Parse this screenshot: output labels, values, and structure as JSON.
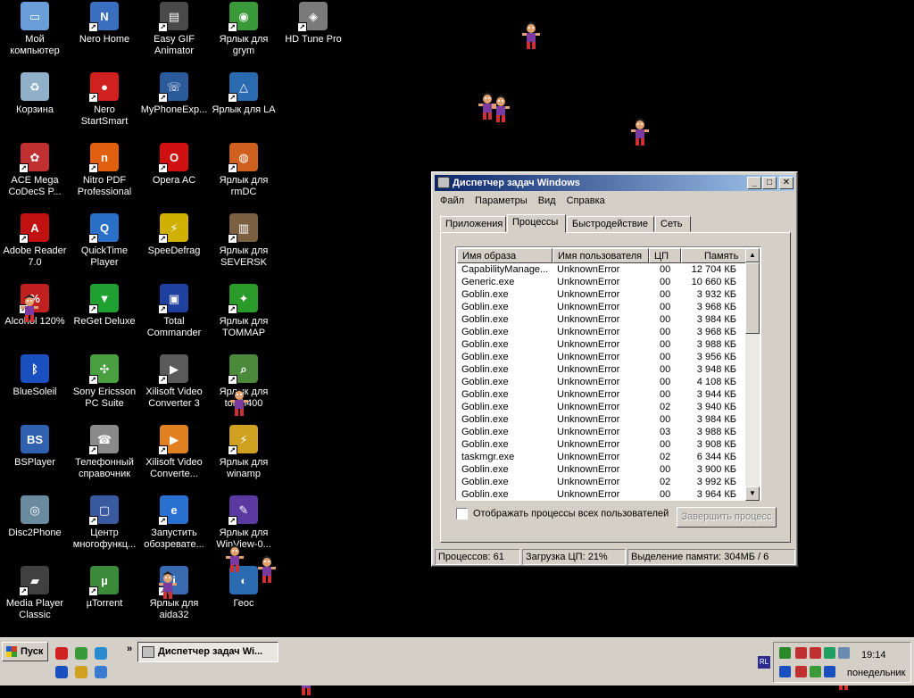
{
  "desktop_icons": [
    {
      "label": "Мой\nкомпьютер",
      "icon": "my-computer-icon",
      "color": "#6a9ed8",
      "glyph": "▭",
      "shortcut": false
    },
    {
      "label": "Nero Home",
      "icon": "nero-home-icon",
      "color": "#3a6fc0",
      "glyph": "N",
      "shortcut": true
    },
    {
      "label": "Easy GIF\nAnimator",
      "icon": "film-icon",
      "color": "#4a4a4a",
      "glyph": "▤",
      "shortcut": true
    },
    {
      "label": "Ярлык для\ngrym",
      "icon": "grym-icon",
      "color": "#3a9a3a",
      "glyph": "◉",
      "shortcut": true
    },
    {
      "label": "HD Tune Pro",
      "icon": "hd-tune-icon",
      "color": "#7a7a7a",
      "glyph": "◈",
      "shortcut": true
    },
    {
      "label": "Корзина",
      "icon": "recycle-bin-icon",
      "color": "#8fb0c8",
      "glyph": "♻",
      "shortcut": false
    },
    {
      "label": "Nero\nStartSmart",
      "icon": "nero-startsmart-icon",
      "color": "#d02020",
      "glyph": "●",
      "shortcut": true
    },
    {
      "label": "MyPhoneExp...",
      "icon": "myphone-icon",
      "color": "#2a5a9a",
      "glyph": "☏",
      "shortcut": true
    },
    {
      "label": "Ярлык для LA",
      "icon": "la-icon",
      "color": "#2a6ab0",
      "glyph": "△",
      "shortcut": true
    },
    {
      "label": "ACE Mega\nCoDecS P...",
      "icon": "ace-codec-icon",
      "color": "#c03030",
      "glyph": "✿",
      "shortcut": true
    },
    {
      "label": "Nitro PDF\nProfessional",
      "icon": "nitro-pdf-icon",
      "color": "#e06010",
      "glyph": "n",
      "shortcut": true
    },
    {
      "label": "Opera AC",
      "icon": "opera-icon",
      "color": "#d01010",
      "glyph": "O",
      "shortcut": true
    },
    {
      "label": "Ярлык для\nrmDC",
      "icon": "rmdc-icon",
      "color": "#d06020",
      "glyph": "◍",
      "shortcut": true
    },
    {
      "label": "Adobe Reader\n7.0",
      "icon": "adobe-reader-icon",
      "color": "#c01010",
      "glyph": "A",
      "shortcut": true
    },
    {
      "label": "QuickTime\nPlayer",
      "icon": "quicktime-icon",
      "color": "#2a70c8",
      "glyph": "Q",
      "shortcut": true
    },
    {
      "label": "SpeeDefrag",
      "icon": "lightning-icon",
      "color": "#d0b000",
      "glyph": "⚡",
      "shortcut": true
    },
    {
      "label": "Ярлык для\nSEVERSK",
      "icon": "book-icon",
      "color": "#7a6040",
      "glyph": "▥",
      "shortcut": true
    },
    {
      "label": "Alcohol 120%",
      "icon": "alcohol-icon",
      "color": "#c02020",
      "glyph": "%",
      "shortcut": true
    },
    {
      "label": "ReGet Deluxe",
      "icon": "reget-icon",
      "color": "#20a030",
      "glyph": "▼",
      "shortcut": true
    },
    {
      "label": "Total\nCommander",
      "icon": "floppy-icon",
      "color": "#2040a0",
      "glyph": "▣",
      "shortcut": true
    },
    {
      "label": "Ярлык для\nTOMMAP",
      "icon": "tommap-icon",
      "color": "#2a9a2a",
      "glyph": "✦",
      "shortcut": true
    },
    {
      "label": "BlueSoleil",
      "icon": "bluetooth-icon",
      "color": "#1a4fc0",
      "glyph": "ᛒ",
      "shortcut": false
    },
    {
      "label": "Sony Ericsson\nPC Suite",
      "icon": "sony-ericsson-icon",
      "color": "#4aa040",
      "glyph": "✣",
      "shortcut": true
    },
    {
      "label": "Xilisoft Video\nConverter 3",
      "icon": "video-converter-icon",
      "color": "#5a5a5a",
      "glyph": "▶",
      "shortcut": true
    },
    {
      "label": "Ярлык для\ntorch400",
      "icon": "magnifier-icon",
      "color": "#4a8a3a",
      "glyph": "⌕",
      "shortcut": true
    },
    {
      "label": "BSPlayer",
      "icon": "bsplayer-icon",
      "color": "#3060b0",
      "glyph": "BS",
      "shortcut": false
    },
    {
      "label": "Телефонный\nсправочник",
      "icon": "telephone-icon",
      "color": "#8a8a8a",
      "glyph": "☎",
      "shortcut": true
    },
    {
      "label": "Xilisoft Video\nConverte...",
      "icon": "video-converter-icon",
      "color": "#e08020",
      "glyph": "▶",
      "shortcut": true
    },
    {
      "label": "Ярлык для\nwinamp",
      "icon": "winamp-icon",
      "color": "#d0a020",
      "glyph": "⚡",
      "shortcut": true
    },
    {
      "label": "Disc2Phone",
      "icon": "disc2phone-icon",
      "color": "#6a8aa0",
      "glyph": "◎",
      "shortcut": false
    },
    {
      "label": "Центр\nмногофункц...",
      "icon": "multifunction-center-icon",
      "color": "#3a5aa0",
      "glyph": "▢",
      "shortcut": true
    },
    {
      "label": "Запустить\nобозревате...",
      "icon": "internet-explorer-icon",
      "color": "#2a70d0",
      "glyph": "e",
      "shortcut": true
    },
    {
      "label": "Ярлык для\nWinView-0...",
      "icon": "winview-icon",
      "color": "#5a3aa0",
      "glyph": "✎",
      "shortcut": true
    },
    {
      "label": "Media Player\nClassic",
      "icon": "clapperboard-icon",
      "color": "#404040",
      "glyph": "▰",
      "shortcut": true
    },
    {
      "label": "µTorrent",
      "icon": "utorrent-icon",
      "color": "#3a8a3a",
      "glyph": "µ",
      "shortcut": true
    },
    {
      "label": "Ярлык для\naida32",
      "icon": "aida32-icon",
      "color": "#3a6ab0",
      "glyph": "i",
      "shortcut": true
    },
    {
      "label": "Геос",
      "icon": "globe-icon",
      "color": "#2a6ab0",
      "glyph": "◐",
      "shortcut": false
    }
  ],
  "task_manager": {
    "title": "Диспетчер задач Windows",
    "menu": [
      "Файл",
      "Параметры",
      "Вид",
      "Справка"
    ],
    "tabs": [
      "Приложения",
      "Процессы",
      "Быстродействие",
      "Сеть"
    ],
    "active_tab": "Процессы",
    "columns": [
      "Имя образа",
      "Имя пользователя",
      "ЦП",
      "Память"
    ],
    "processes": [
      {
        "name": "CapabilityManage...",
        "user": "UnknownError",
        "cpu": "00",
        "mem": "12 704 КБ"
      },
      {
        "name": "Generic.exe",
        "user": "UnknownError",
        "cpu": "00",
        "mem": "10 660 КБ"
      },
      {
        "name": "Goblin.exe",
        "user": "UnknownError",
        "cpu": "00",
        "mem": "3 932 КБ"
      },
      {
        "name": "Goblin.exe",
        "user": "UnknownError",
        "cpu": "00",
        "mem": "3 968 КБ"
      },
      {
        "name": "Goblin.exe",
        "user": "UnknownError",
        "cpu": "00",
        "mem": "3 984 КБ"
      },
      {
        "name": "Goblin.exe",
        "user": "UnknownError",
        "cpu": "00",
        "mem": "3 968 КБ"
      },
      {
        "name": "Goblin.exe",
        "user": "UnknownError",
        "cpu": "00",
        "mem": "3 988 КБ"
      },
      {
        "name": "Goblin.exe",
        "user": "UnknownError",
        "cpu": "00",
        "mem": "3 956 КБ"
      },
      {
        "name": "Goblin.exe",
        "user": "UnknownError",
        "cpu": "00",
        "mem": "3 948 КБ"
      },
      {
        "name": "Goblin.exe",
        "user": "UnknownError",
        "cpu": "00",
        "mem": "4 108 КБ"
      },
      {
        "name": "Goblin.exe",
        "user": "UnknownError",
        "cpu": "00",
        "mem": "3 944 КБ"
      },
      {
        "name": "Goblin.exe",
        "user": "UnknownError",
        "cpu": "02",
        "mem": "3 940 КБ"
      },
      {
        "name": "Goblin.exe",
        "user": "UnknownError",
        "cpu": "00",
        "mem": "3 984 КБ"
      },
      {
        "name": "Goblin.exe",
        "user": "UnknownError",
        "cpu": "03",
        "mem": "3 988 КБ"
      },
      {
        "name": "Goblin.exe",
        "user": "UnknownError",
        "cpu": "00",
        "mem": "3 908 КБ"
      },
      {
        "name": "taskmgr.exe",
        "user": "UnknownError",
        "cpu": "02",
        "mem": "6 344 КБ"
      },
      {
        "name": "Goblin.exe",
        "user": "UnknownError",
        "cpu": "00",
        "mem": "3 900 КБ"
      },
      {
        "name": "Goblin.exe",
        "user": "UnknownError",
        "cpu": "02",
        "mem": "3 992 КБ"
      },
      {
        "name": "Goblin.exe",
        "user": "UnknownError",
        "cpu": "00",
        "mem": "3 964 КБ"
      }
    ],
    "show_all_label": "Отображать процессы всех пользователей",
    "end_process_label": "Завершить процесс",
    "status": {
      "processes": "Процессов: 61",
      "cpu": "Загрузка ЦП: 21%",
      "memory": "Выделение памяти: 304МБ / 6"
    }
  },
  "taskbar": {
    "start_label": "Пуск",
    "quick_launch": [
      "opera-icon",
      "tree-icon",
      "skype-icon",
      "bluetooth-icon",
      "winamp-icon",
      "messenger-icon"
    ],
    "task_label": "Диспетчер задач Wi...",
    "language": "RL",
    "clock_time": "19:14",
    "clock_day": "понедельник",
    "tray_icons": [
      "network-icon",
      "antivirus-icon",
      "firewall-icon",
      "kaspersky-icon",
      "monitor-icon",
      "bluetooth-icon",
      "dollar-icon",
      "clock-icon",
      "disk-icon"
    ]
  },
  "colors": {
    "desktop": "#000000",
    "window_face": "#d4d0c8",
    "title_active": "#0a246a"
  }
}
